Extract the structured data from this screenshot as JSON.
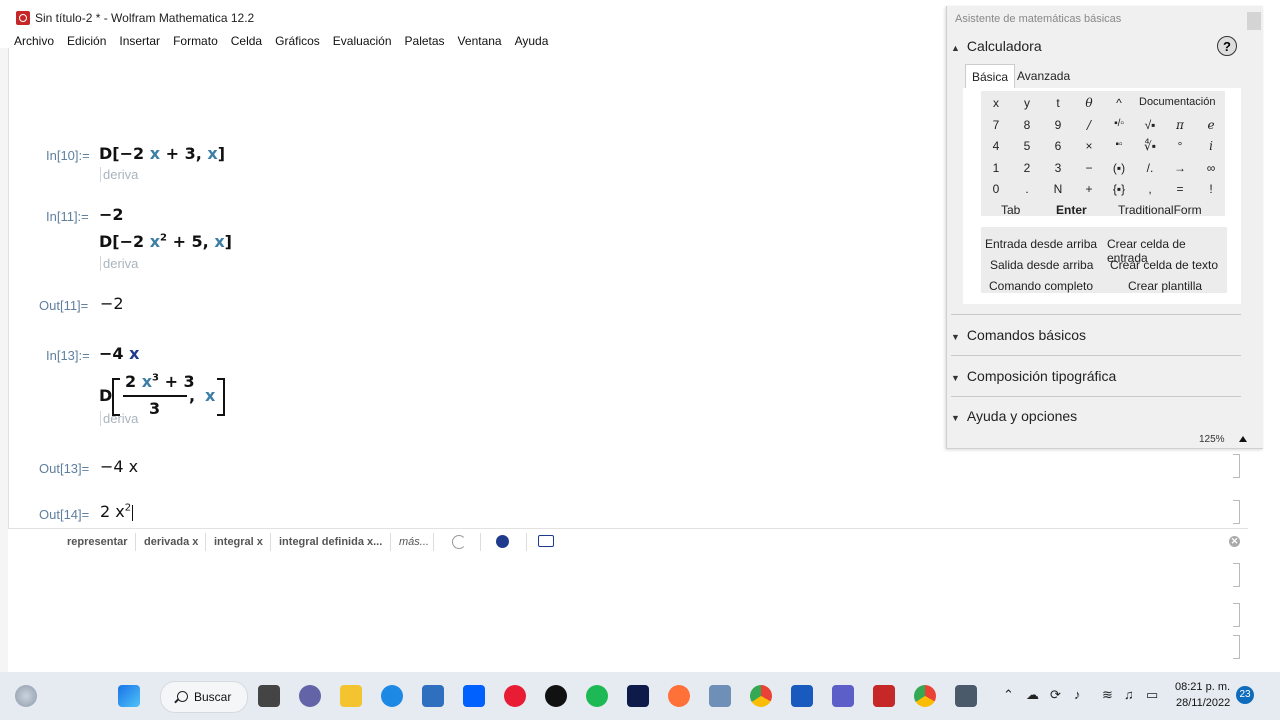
{
  "window": {
    "title": "Sin título-2 * - Wolfram Mathematica 12.2"
  },
  "menu": [
    "Archivo",
    "Edición",
    "Insertar",
    "Formato",
    "Celda",
    "Gráficos",
    "Evaluación",
    "Paletas",
    "Ventana",
    "Ayuda"
  ],
  "notebook": {
    "in10_label": "In[10]:=",
    "in10_expr_a": "D[−2 ",
    "in10_expr_var": "x",
    "in10_expr_b": " + 3, ",
    "in10_expr_c": "]",
    "in10_hint": "deriva",
    "in11_label": "In[11]:=",
    "in11_line1": "−2",
    "in11_expr_a": "D[−2 ",
    "in11_expr_var": "x",
    "in11_expr_exp": "2",
    "in11_expr_b": " + 5, ",
    "in11_expr_c": "]",
    "in11_hint": "deriva",
    "out11_label": "Out[11]=",
    "out11_value": "−2",
    "in13_label": "In[13]:=",
    "in13_line1_a": "−4 ",
    "in13_line1_var": "x",
    "in13_D": "D",
    "in13_num_a": "2 ",
    "in13_num_var": "x",
    "in13_num_exp": "3",
    "in13_num_b": " + 3",
    "in13_den": "3",
    "in13_tail": ",",
    "in13_hint": "deriva",
    "out13_label": "Out[13]=",
    "out13_value": "−4 x",
    "out14_label": "Out[14]=",
    "out14_value": "2 x",
    "out14_exp": "2"
  },
  "suggestions": [
    "representar",
    "derivada x",
    "integral x",
    "integral definida x...",
    "más..."
  ],
  "palette": {
    "title": "Asistente de matemáticas básicas",
    "calc_title": "Calculadora",
    "help": "?",
    "tabs": [
      "Básica",
      "Avanzada"
    ],
    "keys_row1": [
      "x",
      "y",
      "t",
      "θ",
      "^",
      "Documentación"
    ],
    "keys_row2": [
      "7",
      "8",
      "9",
      "/",
      "▪/▫",
      "√▪",
      "π",
      "e"
    ],
    "keys_row3": [
      "4",
      "5",
      "6",
      "×",
      "▪▫",
      "∜▪",
      "°",
      "i"
    ],
    "keys_row4": [
      "1",
      "2",
      "3",
      "−",
      "(▪)",
      "/.",
      "→",
      "∞"
    ],
    "keys_row5": [
      "0",
      ".",
      "N",
      "+",
      "{▪}",
      ",",
      "=",
      "!"
    ],
    "keys_row6": [
      "Tab",
      "Enter",
      "TraditionalForm"
    ],
    "actions": [
      "Entrada desde arriba",
      "Crear celda de entrada",
      "Salida desde arriba",
      "Crear celda de texto",
      "Comando completo",
      "Crear plantilla"
    ],
    "sections": [
      "Comandos básicos",
      "Composición tipográfica",
      "Ayuda y opciones"
    ],
    "zoom": "125%"
  },
  "taskbar": {
    "search": "Buscar",
    "time": "08:21 p. m.",
    "date": "28/11/2022",
    "notifications": "23",
    "icons": [
      "start-icon",
      "search-icon",
      "task-view-icon",
      "chat-icon",
      "file-explorer-icon",
      "edge-icon",
      "store-icon",
      "dropbox-icon",
      "opera-icon",
      "github-icon",
      "spotify-icon",
      "disney-icon",
      "firefox-icon",
      "virtualbox-icon",
      "chrome-icon",
      "word-icon",
      "teams-icon",
      "mathematica-icon",
      "chrome-icon-2",
      "app-icon"
    ]
  },
  "colors": {
    "accent": "#3d7ea6",
    "label": "#5f7fa0",
    "taskbar": "#e6ebf1",
    "logo": "#c62828"
  }
}
